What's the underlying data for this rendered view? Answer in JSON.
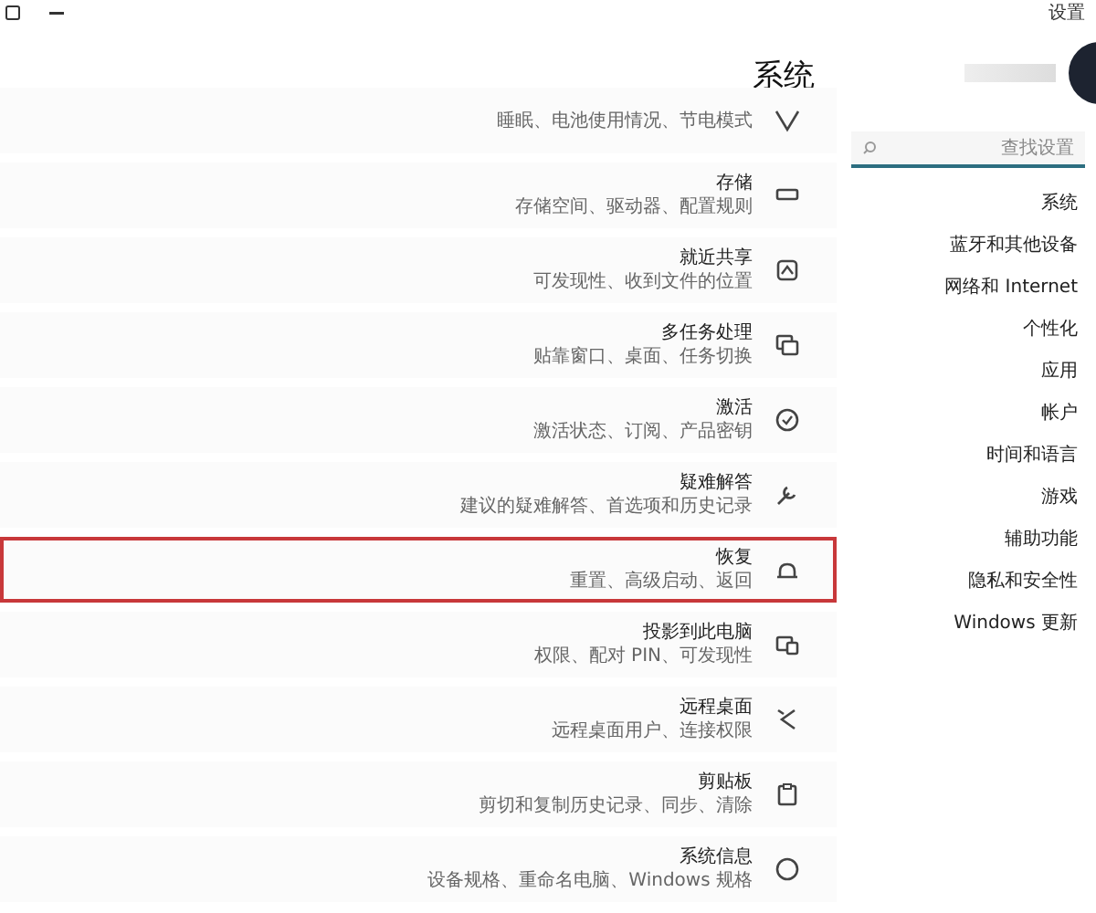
{
  "window": {
    "title": "设置"
  },
  "page": {
    "title": "系统"
  },
  "rows": [
    {
      "title": "",
      "subtitle": "睡眠、电池使用情况、节电模式",
      "highlighted": false
    },
    {
      "title": "存储",
      "subtitle": "存储空间、驱动器、配置规则",
      "highlighted": false
    },
    {
      "title": "就近共享",
      "subtitle": "可发现性、收到文件的位置",
      "highlighted": false
    },
    {
      "title": "多任务处理",
      "subtitle": "贴靠窗口、桌面、任务切换",
      "highlighted": false
    },
    {
      "title": "激活",
      "subtitle": "激活状态、订阅、产品密钥",
      "highlighted": false
    },
    {
      "title": "疑难解答",
      "subtitle": "建议的疑难解答、首选项和历史记录",
      "highlighted": false
    },
    {
      "title": "恢复",
      "subtitle": "重置、高级启动、返回",
      "highlighted": true
    },
    {
      "title": "投影到此电脑",
      "subtitle": "权限、配对 PIN、可发现性",
      "highlighted": false
    },
    {
      "title": "远程桌面",
      "subtitle": "远程桌面用户、连接权限",
      "highlighted": false
    },
    {
      "title": "剪贴板",
      "subtitle": "剪切和复制历史记录、同步、清除",
      "highlighted": false
    },
    {
      "title": "系统信息",
      "subtitle": "设备规格、重命名电脑、Windows 规格",
      "highlighted": false
    }
  ],
  "search": {
    "placeholder": "查找设置"
  },
  "sidebar": {
    "items": [
      {
        "label": "系统",
        "selected": false
      },
      {
        "label": "蓝牙和其他设备",
        "selected": false
      },
      {
        "label": "网络和 Internet",
        "selected": false
      },
      {
        "label": "个性化",
        "selected": false
      },
      {
        "label": "应用",
        "selected": false
      },
      {
        "label": "帐户",
        "selected": false
      },
      {
        "label": "时间和语言",
        "selected": false
      },
      {
        "label": "游戏",
        "selected": false
      },
      {
        "label": "辅助功能",
        "selected": false
      },
      {
        "label": "隐私和安全性",
        "selected": false
      },
      {
        "label": "Windows 更新",
        "selected": false
      }
    ]
  }
}
